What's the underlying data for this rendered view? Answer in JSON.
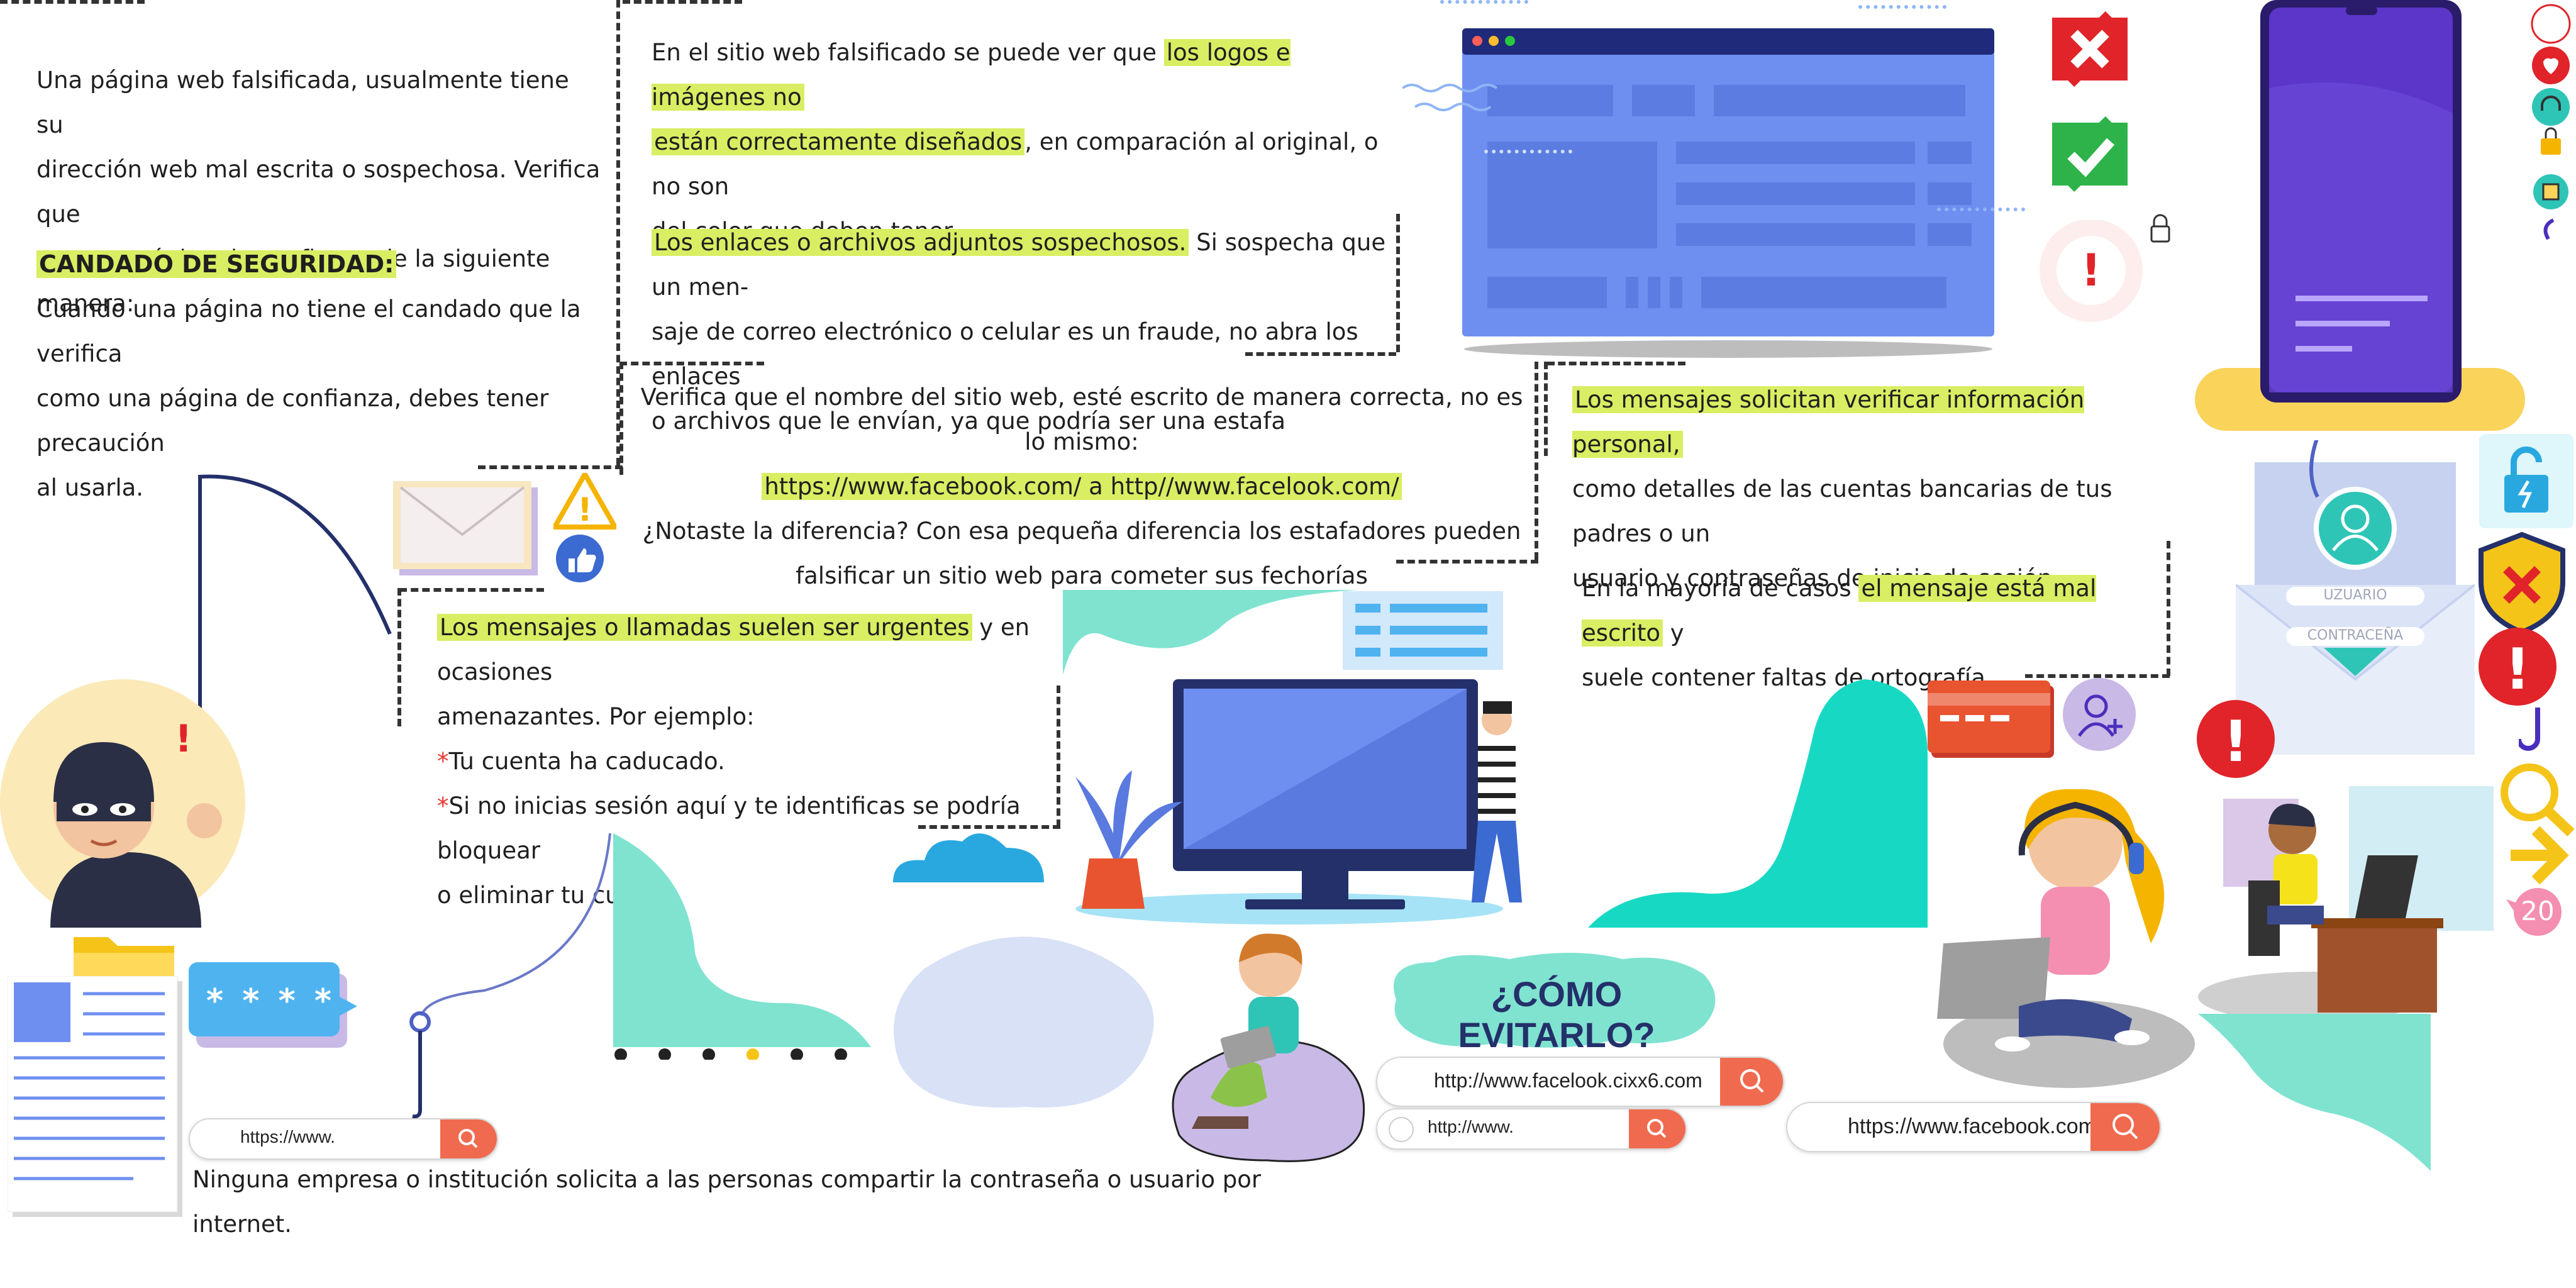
{
  "text": {
    "intro": [
      "Una página web falsificada, usualmente tiene su",
      "dirección web mal escrita o sospechosa.  Verifica que",
      "sea una página de confianza de la siguiente manera:"
    ],
    "padlock_title": "CANDADO DE SEGURIDAD:",
    "padlock_body": [
      "Cuando una página no tiene el candado que la verifica",
      "como una página de confianza, debes tener precaución",
      "al usarla."
    ],
    "logos_pre": "En el sitio web falsificado se puede ver que ",
    "logos_hl1": "los logos e imágenes no",
    "logos_hl2": "están correctamente diseñados",
    "logos_post": ", en comparación al original, o no son",
    "logos_line3": "del color que deben tener.",
    "links_hl": "Los enlaces o archivos adjuntos sospechosos.",
    "links_post": " Si sospecha que un men-",
    "links_line2": "saje de correo electrónico o  celular es un fraude, no abra los enlaces",
    "links_line3": "o archivos que le envían, ya que podría ser una estafa",
    "verify_line1": "Verifica que el nombre del sitio web, esté escrito de manera correcta, no es lo mismo:",
    "verify_urls": "https://www.facebook.com/  a  http//www.facelook.com/",
    "verify_line3": "¿Notaste la diferencia? Con esa pequeña diferencia los estafadores pueden",
    "verify_line4": "falsificar un sitio web para cometer sus fechorías",
    "personal_hl": "Los mensajes solicitan verificar información personal,",
    "personal_line2": "como detalles de las cuentas bancarias de tus padres o un",
    "personal_line3": "usuario y contraseñas de inicio de sesión.",
    "badly_pre": "En la mayoría de casos ",
    "badly_hl": "el mensaje está mal escrito",
    "badly_post": " y",
    "badly_line2": "suele contener faltas de ortografía.",
    "urgent_hl": "Los mensajes o llamadas suelen ser urgentes",
    "urgent_post": " y en ocasiones",
    "urgent_line2": "amenazantes. Por ejemplo:",
    "urgent_star1": "*",
    "urgent_item1": "Tu cuenta ha caducado.",
    "urgent_star2": "*",
    "urgent_item2": "Si no inicias sesión aquí y te identificas se podría bloquear",
    "urgent_line5": "o eliminar tu cuenta.",
    "bottom_note": "Ninguna empresa o institución solicita a las personas compartir la contraseña o usuario por internet.",
    "como_evitarlo": "¿CÓMO EVITARLO?",
    "envelope_user": "UZUARIO",
    "envelope_pass": "CONTRACEÑA",
    "password_mask": "* * * *",
    "badge_number": "20",
    "urls": {
      "left": "https://www.",
      "middle1": "http://www.facelook.cixx6.com",
      "middle2": "http://www.",
      "right": "https://www.facebook.com"
    }
  },
  "colors": {
    "highlight": "#d9ee62",
    "teal": "#7fe3d0",
    "search_orange": "#f06a4f",
    "monitor_blue": "#6f8ff0",
    "phone_purple": "#5b36c9",
    "alert_red": "#e0242a",
    "success_green": "#2db34a"
  },
  "icons": [
    "search-icon",
    "padlock-icon",
    "warning-icon",
    "like-icon",
    "envelope-icon",
    "folder-icon",
    "document-icon",
    "hook-icon",
    "x-icon",
    "check-icon",
    "alert-icon",
    "shield-icon",
    "credit-card-icon",
    "add-user-icon",
    "magnifier-icon",
    "arrow-right-icon",
    "heart-icon",
    "headphones-icon"
  ]
}
